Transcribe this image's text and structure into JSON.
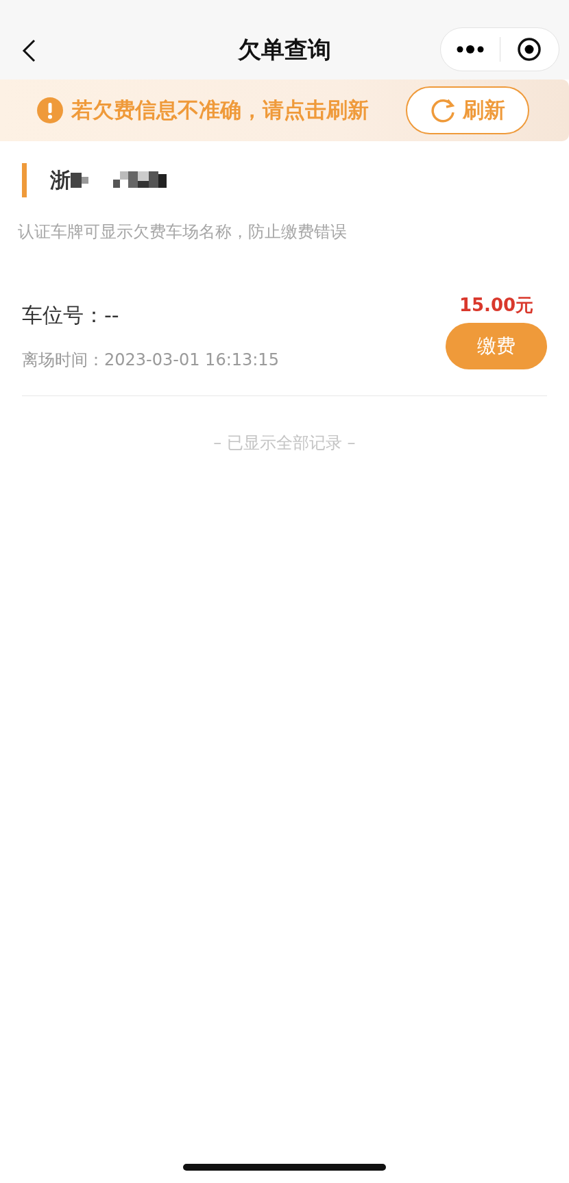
{
  "nav": {
    "title": "欠单查询"
  },
  "notice": {
    "text": "若欠费信息不准确，请点击刷新",
    "button": "刷新"
  },
  "plate": {
    "text": "浙",
    "redacted": true
  },
  "hint": "认证车牌可显示欠费车场名称，防止缴费错误",
  "bills": [
    {
      "spot": "车位号：--",
      "time": "离场时间：2023-03-01 16:13:15",
      "amount": "15.00元",
      "button": "缴费"
    }
  ],
  "footer": "– 已显示全部记录 –"
}
